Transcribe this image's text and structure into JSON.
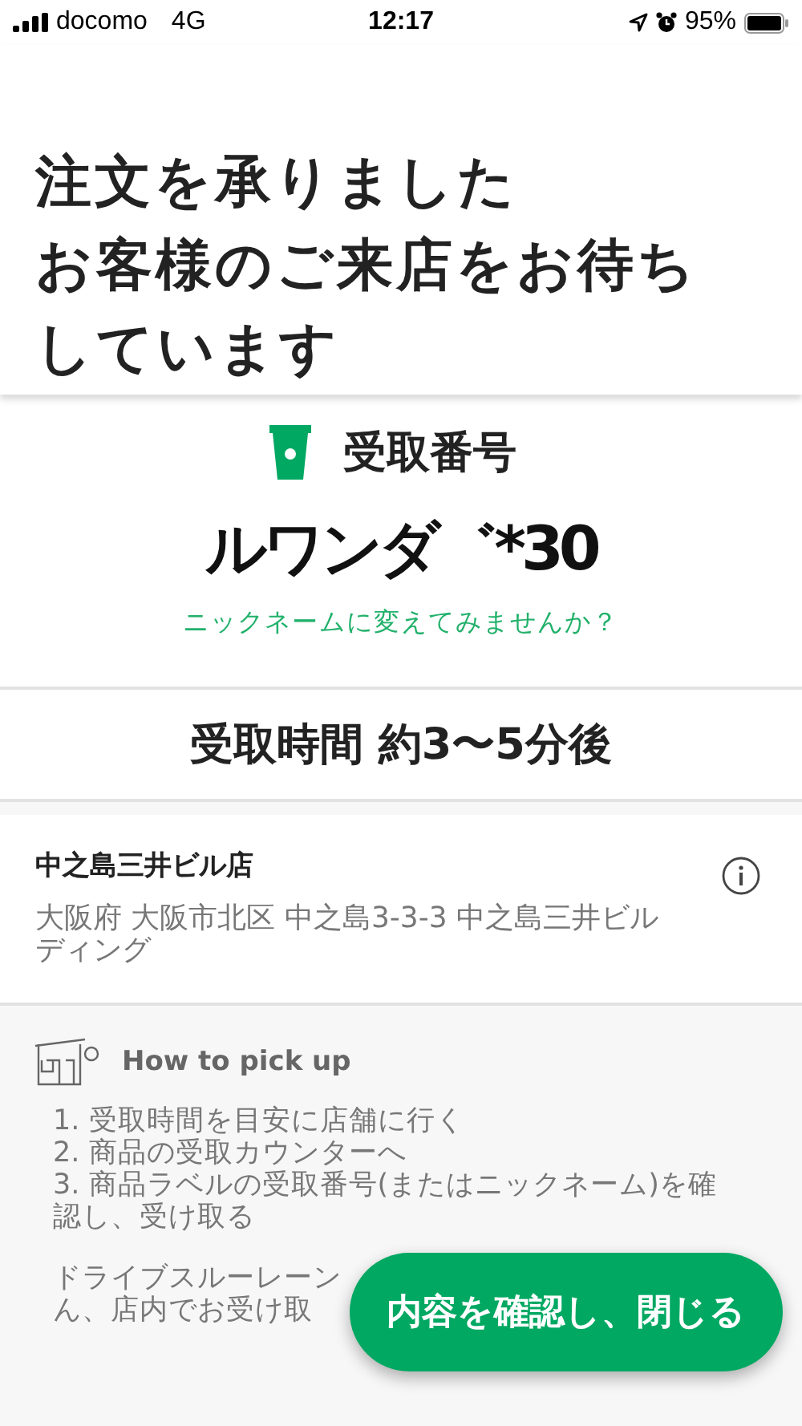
{
  "status_bar": {
    "carrier": "docomo",
    "network": "4G",
    "time": "12:17",
    "battery": "95%"
  },
  "title_lines": [
    "注文を承りました",
    "お客様のご来店をお待ち",
    "しています"
  ],
  "pickup": {
    "label": "受取番号",
    "number": "ルワンダ゛*30",
    "nickname_link": "ニックネームに変えてみませんか？"
  },
  "pickup_time": "受取時間 約3〜5分後",
  "store": {
    "name": "中之島三井ビル店",
    "address": "大阪府 大阪市北区 中之島3-3-3 中之島三井ビルディング"
  },
  "how_to": {
    "heading": "How to pick up",
    "steps": [
      "1. 受取時間を目安に店舗に行く",
      "2. 商品の受取カウンターへ",
      "3. 商品ラベルの受取番号(またはニックネーム)を確認し、受け取る"
    ],
    "note_lines": [
      "ドライブスルーレーン",
      "ん、店内でお受け取"
    ]
  },
  "confirm_button": "内容を確認し、閉じる"
}
